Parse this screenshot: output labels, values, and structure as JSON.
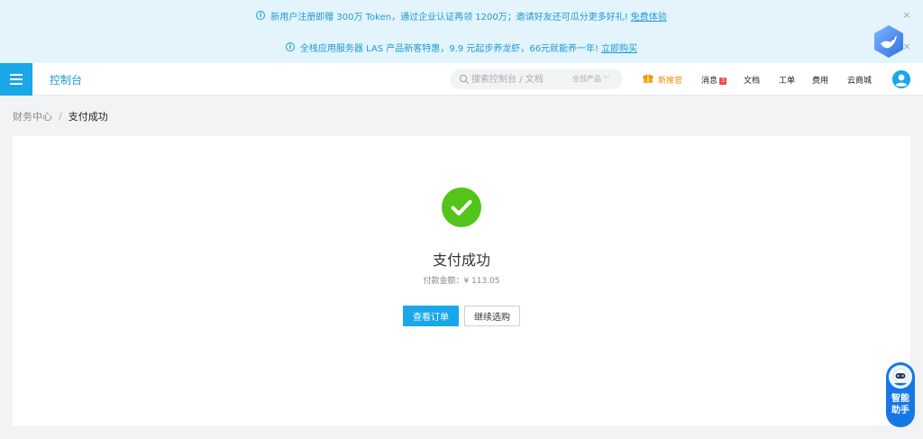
{
  "banners": [
    {
      "text": "新用户注册即赠 300万 Token，通过企业认证再领 1200万；邀请好友还可瓜分更多好礼!",
      "link": "免费体验"
    },
    {
      "text": "全栈应用服务器 LAS 产品新客特惠，9.9 元起步养龙虾，66元就能养一年!",
      "link": "立即购买"
    }
  ],
  "banner_close_glyph": "×",
  "header": {
    "console_title": "控制台",
    "search_placeholder": "搜索控制台 / 文档",
    "search_scope": "全部产品",
    "nav": {
      "new_recommend": "新推官",
      "messages": "消息",
      "messages_badge": "3",
      "docs": "文档",
      "tickets": "工单",
      "billing": "费用",
      "marketplace": "云商城"
    }
  },
  "breadcrumb": {
    "parent": "财务中心",
    "separator": "/",
    "current": "支付成功"
  },
  "result": {
    "title": "支付成功",
    "amount": "付款金额：¥ 113.05",
    "primary_button": "查看订单",
    "secondary_button": "继续选购"
  },
  "assistant": {
    "label_line1": "智能",
    "label_line2": "助手"
  },
  "colors": {
    "accent": "#1aa7e8",
    "banner_bg": "#e3f4fc",
    "banner_text": "#1d9bd1",
    "success": "#52c41a",
    "new_recommend": "#f08c00",
    "badge": "#f04a4a",
    "assistant": "#1677e6"
  },
  "icons": {
    "banner_info": "info-circle-icon",
    "menu": "hamburger-menu-icon",
    "search": "search-icon",
    "gift": "gift-icon",
    "avatar": "user-avatar-icon",
    "success": "check-circle-icon",
    "brand": "bird-shield-logo-icon"
  }
}
